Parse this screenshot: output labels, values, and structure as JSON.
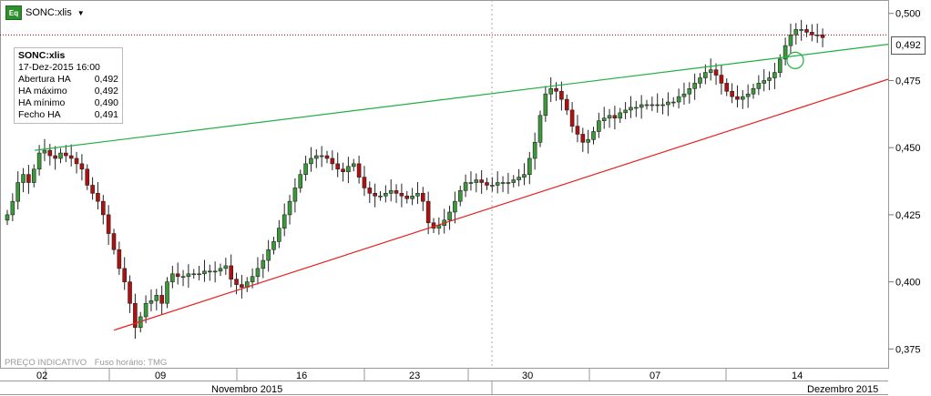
{
  "ticker": {
    "label": "SONC:xlis",
    "icon_text": "Eq"
  },
  "info_box": {
    "symbol": "SONC:xlis",
    "datetime": "17-Dez-2015 16:00",
    "rows": [
      {
        "label": "Abertura HA",
        "value": "0,492"
      },
      {
        "label": "HA máximo",
        "value": "0,492"
      },
      {
        "label": "HA mínimo",
        "value": "0,490"
      },
      {
        "label": "Fecho HA",
        "value": "0,491"
      }
    ]
  },
  "last_price_label": "0,492",
  "footer": {
    "indicative": "PREÇO INDICATIVO",
    "timezone": "Fuso horário: TMG"
  },
  "colors": {
    "candle_up": "#3a9a3a",
    "candle_down": "#b01010",
    "support_line": "#e82020",
    "resistance_line": "#20b040",
    "last_price_line": "#a00000"
  },
  "chart_data": {
    "type": "candlestick",
    "y_ticks": [
      "0,375",
      "0,400",
      "0,425",
      "0,450",
      "0,475",
      "0,500"
    ],
    "ylim": [
      0.368,
      0.505
    ],
    "x_ticks": [
      "02",
      "09",
      "16",
      "23",
      "30",
      "07",
      "14"
    ],
    "month_labels": [
      "Novembro 2015",
      "Dezembro 2015"
    ],
    "last_price": 0.492,
    "series_close": [
      0.425,
      0.43,
      0.437,
      0.44,
      0.437,
      0.442,
      0.448,
      0.449,
      0.447,
      0.446,
      0.448,
      0.447,
      0.446,
      0.444,
      0.442,
      0.436,
      0.433,
      0.43,
      0.425,
      0.418,
      0.412,
      0.405,
      0.4,
      0.392,
      0.383,
      0.387,
      0.392,
      0.393,
      0.395,
      0.392,
      0.4,
      0.403,
      0.402,
      0.402,
      0.403,
      0.403,
      0.403,
      0.404,
      0.404,
      0.404,
      0.405,
      0.406,
      0.401,
      0.399,
      0.398,
      0.4,
      0.402,
      0.405,
      0.408,
      0.412,
      0.415,
      0.42,
      0.425,
      0.43,
      0.435,
      0.44,
      0.444,
      0.446,
      0.447,
      0.447,
      0.446,
      0.444,
      0.442,
      0.441,
      0.443,
      0.444,
      0.439,
      0.435,
      0.433,
      0.432,
      0.432,
      0.433,
      0.434,
      0.433,
      0.432,
      0.431,
      0.432,
      0.433,
      0.43,
      0.422,
      0.42,
      0.421,
      0.423,
      0.426,
      0.43,
      0.434,
      0.437,
      0.437,
      0.438,
      0.437,
      0.436,
      0.436,
      0.437,
      0.437,
      0.437,
      0.438,
      0.439,
      0.44,
      0.446,
      0.452,
      0.462,
      0.47,
      0.472,
      0.471,
      0.468,
      0.464,
      0.458,
      0.455,
      0.452,
      0.453,
      0.456,
      0.46,
      0.461,
      0.462,
      0.461,
      0.463,
      0.464,
      0.465,
      0.465,
      0.466,
      0.466,
      0.466,
      0.466,
      0.466,
      0.467,
      0.467,
      0.469,
      0.47,
      0.472,
      0.474,
      0.476,
      0.478,
      0.479,
      0.477,
      0.474,
      0.471,
      0.469,
      0.468,
      0.469,
      0.47,
      0.472,
      0.474,
      0.475,
      0.476,
      0.478,
      0.483,
      0.488,
      0.492,
      0.494,
      0.494,
      0.493,
      0.492,
      0.492,
      0.491
    ]
  }
}
